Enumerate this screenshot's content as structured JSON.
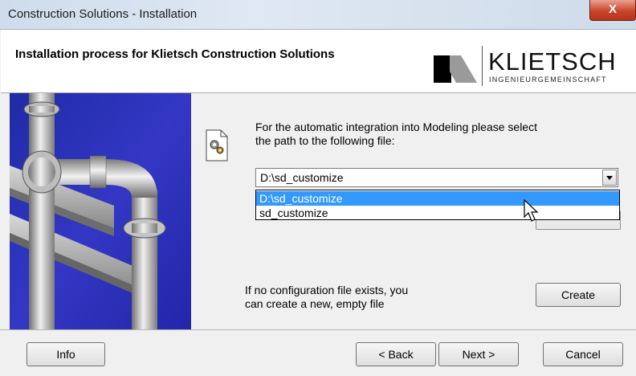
{
  "window": {
    "title": "Construction Solutions - Installation",
    "close_label": "X"
  },
  "header": {
    "title": "Installation process for Klietsch Construction Solutions"
  },
  "logo": {
    "name": "KLIETSCH",
    "subtitle": "INGENIEURGEMEINSCHAFT"
  },
  "main": {
    "prompt_line1": "For the automatic integration into Modeling please select",
    "prompt_line2": "the path to the following file:",
    "combo_value": "D:\\sd_customize",
    "dropdown_options": [
      "D:\\sd_customize",
      "sd_customize"
    ],
    "noconfig_line1": "If no configuration file exists, you",
    "noconfig_line2": "can create a new, empty file",
    "create_label": "Create"
  },
  "footer": {
    "info_label": "Info",
    "back_label": "< Back",
    "next_label": "Next >",
    "cancel_label": "Cancel"
  },
  "colors": {
    "selection": "#3399ff",
    "image_background": "#2b2eb8",
    "close_button": "#c9452c"
  }
}
